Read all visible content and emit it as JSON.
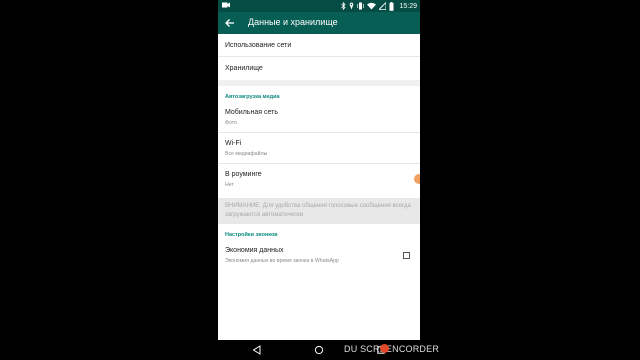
{
  "status_bar": {
    "time": "15:29",
    "left_icon": "video-camera-icon",
    "icons": [
      "bluetooth-icon",
      "location-icon",
      "vibrate-icon",
      "wifi-icon",
      "no-sim-icon",
      "battery-icon"
    ]
  },
  "app_bar": {
    "title": "Данные и хранилище",
    "back_icon": "arrow-back-icon"
  },
  "section1": {
    "items": [
      {
        "label": "Использование сети"
      },
      {
        "label": "Хранилище"
      }
    ]
  },
  "autoload": {
    "header": "Автозагрузка медиа",
    "items": [
      {
        "title": "Мобильная сеть",
        "subtitle": "Фото"
      },
      {
        "title": "Wi-Fi",
        "subtitle": "Все медиафайлы"
      },
      {
        "title": "В роуминге",
        "subtitle": "Нет"
      }
    ],
    "notice": "ВНИМАНИЕ: Для удобства общения голосовые сообщения всегда загружаются автоматически"
  },
  "calls": {
    "header": "Настройки звонков",
    "item": {
      "title": "Экономия данных",
      "subtitle": "Экономия данных во время звонка в WhatsApp",
      "checked": false
    }
  },
  "nav": {
    "back_icon": "nav-back-icon",
    "home_icon": "nav-home-icon",
    "recents_icon": "nav-recents-icon"
  },
  "watermark": {
    "text_left": "DU SCREEN",
    "text_right": "CORDER"
  },
  "colors": {
    "status_bar": "#054d44",
    "app_bar": "#075e54",
    "accent": "#0b8b7d"
  }
}
